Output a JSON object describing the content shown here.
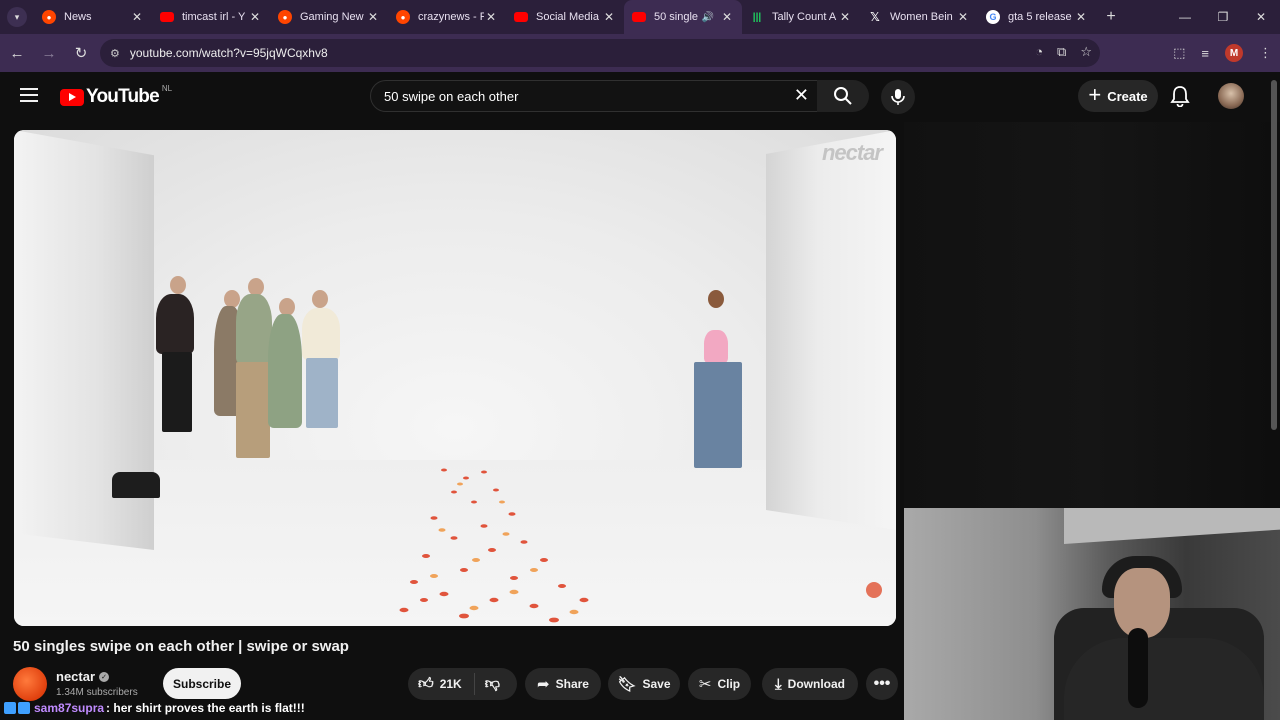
{
  "browser": {
    "tabs": [
      {
        "title": "News",
        "icon": "reddit-icon"
      },
      {
        "title": "timcast irl - Y",
        "icon": "youtube-icon"
      },
      {
        "title": "Gaming New",
        "icon": "reddit-icon"
      },
      {
        "title": "crazynews - F",
        "icon": "reddit-icon"
      },
      {
        "title": "Social Media",
        "icon": "youtube-icon"
      },
      {
        "title": "50 single",
        "icon": "youtube-icon",
        "active": true,
        "audio": true
      },
      {
        "title": "Tally Count A",
        "icon": "tally-icon"
      },
      {
        "title": "Women Bein",
        "icon": "x-icon"
      },
      {
        "title": "gta 5 release",
        "icon": "google-icon"
      }
    ],
    "url": "youtube.com/watch?v=95jqWCqxhv8",
    "profile_initial": "M"
  },
  "youtube": {
    "logo_text": "YouTube",
    "country_code": "NL",
    "search_value": "50 swipe on each other",
    "create_label": "Create"
  },
  "video": {
    "watermark": "nectar",
    "title": "50 singles swipe on each other | swipe or swap",
    "channel_name": "nectar",
    "subscribers": "1.34M subscribers",
    "subscribe_label": "Subscribe",
    "likes": "21K",
    "share_label": "Share",
    "save_label": "Save",
    "clip_label": "Clip",
    "download_label": "Download"
  },
  "chat": {
    "user": "sam87supra",
    "message": ": her shirt proves the earth is flat!!!"
  },
  "colors": {
    "yt_red": "#ff0000",
    "browser_frame": "#3d2c52",
    "chat_user": "#c08bff"
  }
}
